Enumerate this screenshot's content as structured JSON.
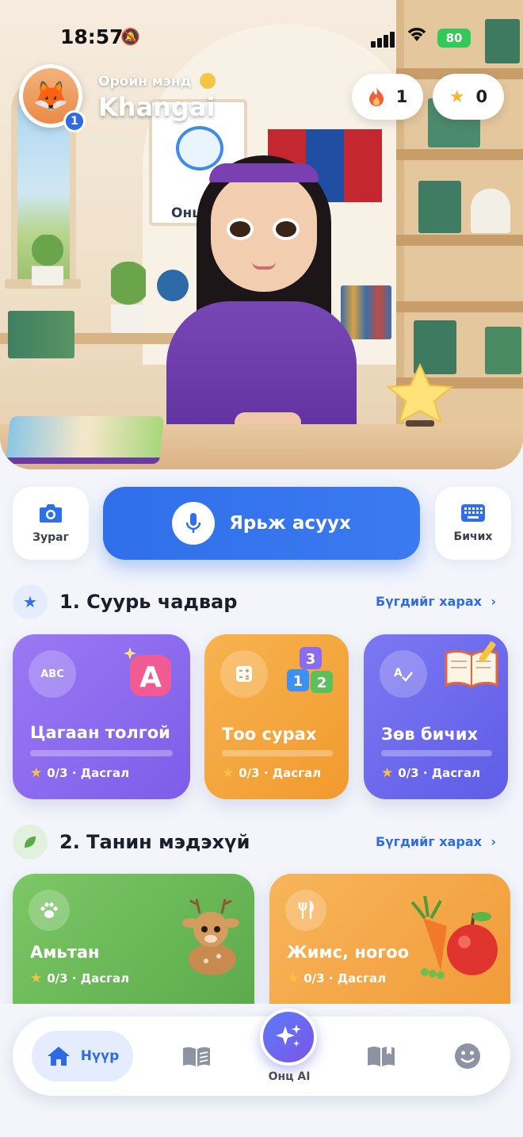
{
  "status_bar": {
    "time": "18:57",
    "battery": "80",
    "battery_color": "#34c759"
  },
  "header": {
    "greeting": "Оройн мэнд",
    "username": "Khangai",
    "avatar_icon": "fox-avatar-icon",
    "avatar_badge": "1",
    "streak_count": "1",
    "stars_count": "0"
  },
  "hero": {
    "board_logo_text": "Онц"
  },
  "quick_actions": {
    "photo_label": "Зураг",
    "speak_label": "Ярьж асуух",
    "write_label": "Бичих",
    "accent": "#2f6fe9"
  },
  "sections": [
    {
      "title": "1. Суурь чадвар",
      "see_all": "Бүгдийг харах",
      "cards": [
        {
          "icon_text": "ABC",
          "title": "Цагаан толгой",
          "progress": 0,
          "meta": "0/3 · Дасгал",
          "color": "#8b6cf0"
        },
        {
          "icon_text": "",
          "title": "Тоо сурах",
          "progress": 0,
          "meta": "0/3 · Дасгал",
          "color": "#f3a53b"
        },
        {
          "icon_text": "",
          "title": "Зөв бичих",
          "progress": 0,
          "meta": "0/3 · Дасгал",
          "color": "#6b6cf0"
        }
      ]
    },
    {
      "title": "2. Танин мэдэхүй",
      "see_all": "Бүгдийг харах",
      "cards": [
        {
          "icon": "paw-icon",
          "title": "Амьтан",
          "meta": "0/3 · Дасгал",
          "color": "#6dbb57"
        },
        {
          "icon": "fork-knife-icon",
          "title": "Жимс, ногоо",
          "meta": "0/3 · Дасгал",
          "color": "#f3a043"
        }
      ]
    }
  ],
  "bottom_nav": {
    "home_label": "Нүүр",
    "ai_label": "Онц AI"
  }
}
